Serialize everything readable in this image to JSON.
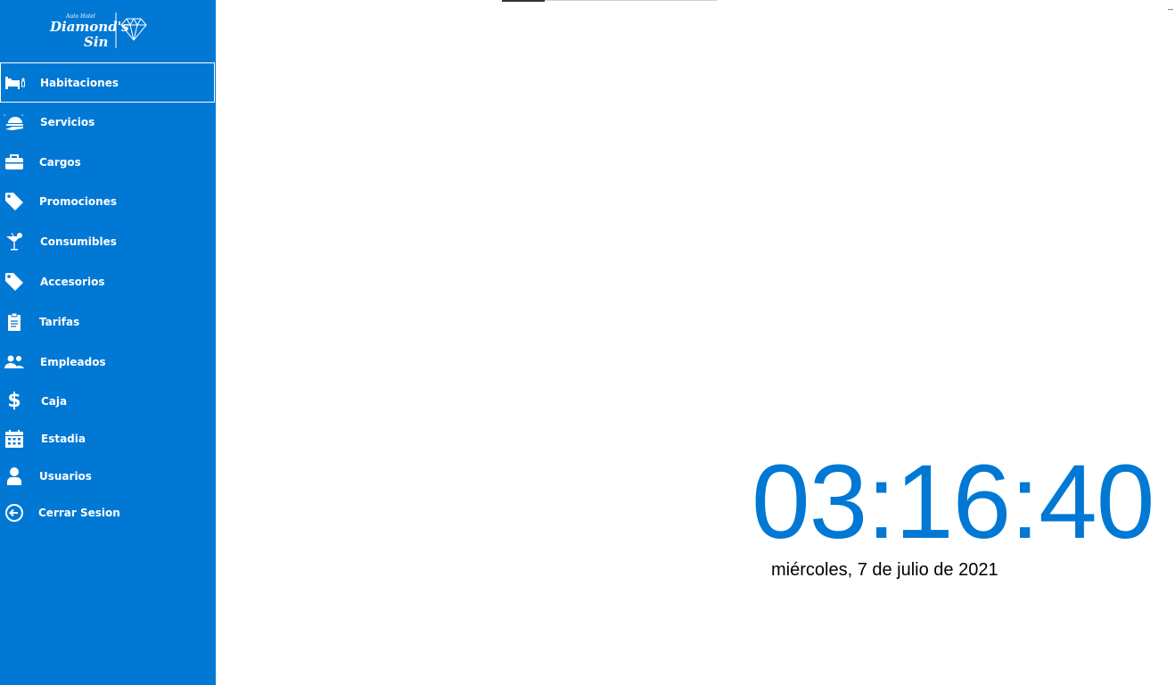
{
  "app": {
    "brand_small": "Auto Hotel",
    "brand_line1": "Diamond's",
    "brand_line2": "Sin"
  },
  "sidebar": {
    "items": [
      {
        "label": "Habitaciones",
        "icon": "bed-icon",
        "active": true
      },
      {
        "label": "Servicios",
        "icon": "room-service-icon"
      },
      {
        "label": "Cargos",
        "icon": "briefcase-icon"
      },
      {
        "label": "Promociones",
        "icon": "tag-icon"
      },
      {
        "label": "Consumibles",
        "icon": "cocktail-icon"
      },
      {
        "label": "Accesorios",
        "icon": "tag-icon"
      },
      {
        "label": "Tarifas",
        "icon": "clipboard-icon"
      },
      {
        "label": "Empleados",
        "icon": "users-icon"
      },
      {
        "label": "Caja",
        "icon": "dollar-icon"
      },
      {
        "label": "Estadia",
        "icon": "calendar-icon"
      },
      {
        "label": "Usuarios",
        "icon": "user-icon"
      },
      {
        "label": "Cerrar Sesion",
        "icon": "logout-icon"
      }
    ]
  },
  "window": {
    "minimize_label": "_"
  },
  "main": {
    "time": "03:16:40",
    "date": "miércoles, 7 de julio de 2021"
  },
  "colors": {
    "accent": "#0078d4",
    "sidebar_text": "#ffffff"
  }
}
